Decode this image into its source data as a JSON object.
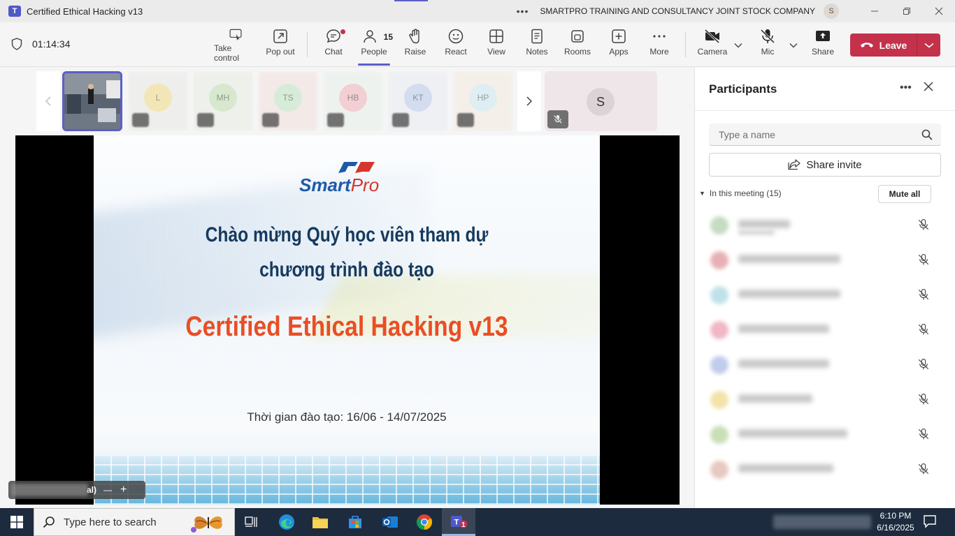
{
  "window": {
    "title": "Certified Ethical Hacking v13",
    "org": "SMARTPRO TRAINING AND CONSULTANCY JOINT STOCK COMPANY",
    "avatar_initial": "S",
    "app_icon": "teams-icon"
  },
  "toolbar": {
    "timer": "01:14:34",
    "take_control": "Take control",
    "pop_out": "Pop out",
    "chat": "Chat",
    "people": "People",
    "people_count": "15",
    "raise": "Raise",
    "react": "React",
    "view": "View",
    "notes": "Notes",
    "rooms": "Rooms",
    "apps": "Apps",
    "more": "More",
    "camera": "Camera",
    "mic": "Mic",
    "share": "Share",
    "leave": "Leave",
    "leave_color": "#c4314b",
    "accent_color": "#5b5fc7"
  },
  "stage": {
    "thumbnail_initials": [
      "L",
      "MH",
      "TS",
      "HB",
      "KT",
      "HP"
    ],
    "pinned_initial": "S"
  },
  "slide": {
    "logo_text_main": "Smart",
    "logo_text_accent": "Pro",
    "line1": "Chào mừng Quý học viên tham dự",
    "line2": "chương trình đào tạo",
    "title": "Certified Ethical Hacking v13",
    "date": "Thời gian đào tạo: 16/06 - 14/07/2025",
    "title_color": "#e94e25",
    "heading_color": "#163a5e"
  },
  "zoom": {
    "suffix": "al)",
    "minus": "—",
    "plus": "+"
  },
  "participants": {
    "title": "Participants",
    "search_placeholder": "Type a name",
    "share_invite": "Share invite",
    "in_meeting": "In this meeting (15)",
    "mute_all": "Mute all"
  },
  "taskbar": {
    "search_placeholder": "Type here to search",
    "time": "6:10 PM",
    "date": "6/16/2025",
    "teams_badge": "1"
  }
}
